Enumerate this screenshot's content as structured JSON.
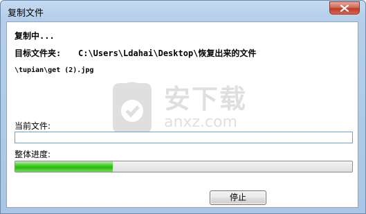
{
  "window": {
    "title": "复制文件"
  },
  "content": {
    "status_text": "复制中...",
    "target_folder_label": "目标文件夹:",
    "target_folder_path": "C:\\Users\\Ldahai\\Desktop\\恢复出来的文件",
    "current_file_path": "\\tupian\\get (2).jpg",
    "current_file_label": "当前文件:",
    "current_file_value": "",
    "overall_progress_label": "整体进度:",
    "overall_progress_fraction": 0.29
  },
  "watermark": {
    "text_cn": "安下载",
    "text_en": "anxz.com"
  },
  "buttons": {
    "stop_label": "停止"
  },
  "colors": {
    "progress_fill": "#3ed121",
    "close_button": "#c0392b"
  }
}
